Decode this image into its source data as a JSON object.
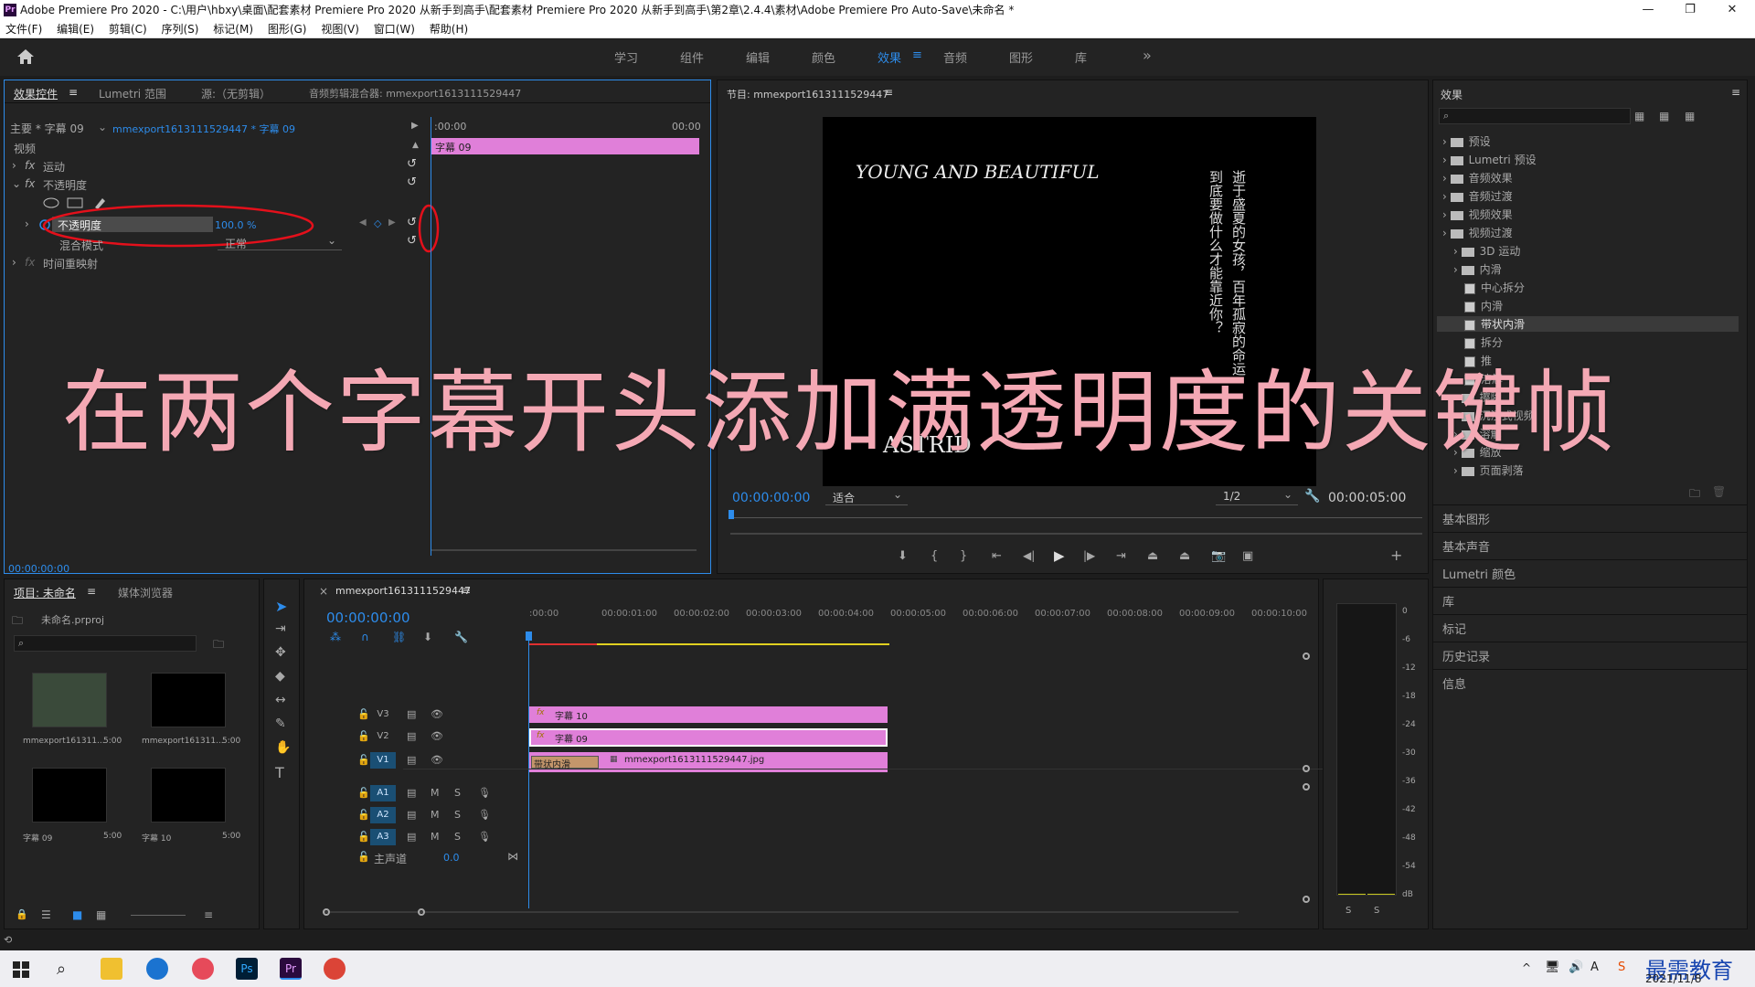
{
  "window": {
    "title": "Adobe Premiere Pro 2020 - C:\\用户\\hbxy\\桌面\\配套素材 Premiere Pro 2020 从新手到高手\\配套素材 Premiere Pro 2020 从新手到高手\\第2章\\2.4.4\\素材\\Adobe Premiere Pro Auto-Save\\未命名 *",
    "logo": "Pr",
    "minimize": "—",
    "restore": "❐",
    "close": "✕"
  },
  "menu": [
    "文件(F)",
    "编辑(E)",
    "剪辑(C)",
    "序列(S)",
    "标记(M)",
    "图形(G)",
    "视图(V)",
    "窗口(W)",
    "帮助(H)"
  ],
  "workspace_tabs": [
    "学习",
    "组件",
    "编辑",
    "颜色",
    "效果",
    "音频",
    "图形",
    "库"
  ],
  "workspace_active": "效果",
  "workspace_more": "»",
  "effect_controls": {
    "tabs": [
      "效果控件",
      "Lumetri 范围",
      "源:（无剪辑）",
      "音频剪辑混合器: mmexport1613111529447"
    ],
    "master_label": "主要 * 字幕 09",
    "sequence_label": "mmexport1613111529447 * 字幕 09",
    "time_start": ":00:00",
    "time_end": "00:00",
    "clip_name": "字幕 09",
    "video_label": "视频",
    "motion": "运动",
    "opacity_group": "不透明度",
    "opacity_prop": "不透明度",
    "opacity_value": "100.0 %",
    "blend_mode_label": "混合模式",
    "blend_mode_value": "正常",
    "time_remap": "时间重映射",
    "fx": "fx",
    "timecode": "00:00:00:00"
  },
  "program_monitor": {
    "title": "节目: mmexport1613111529447",
    "screen_title_en": "YOUNG AND BEAUTIFUL",
    "screen_vertical_1": "逝于盛夏的女孩，百年孤寂的命运",
    "screen_vertical_2": "到底要做什么才能靠近你？",
    "screen_name": "ASTRID",
    "timecode": "00:00:00:00",
    "fit": "适合",
    "resolution": "1/2",
    "duration": "00:00:05:00"
  },
  "effects_panel": {
    "title": "效果",
    "tree": [
      {
        "label": "预设",
        "level": 0,
        "type": "folder"
      },
      {
        "label": "Lumetri 预设",
        "level": 0,
        "type": "folder"
      },
      {
        "label": "音频效果",
        "level": 0,
        "type": "folder"
      },
      {
        "label": "音频过渡",
        "level": 0,
        "type": "folder"
      },
      {
        "label": "视频效果",
        "level": 0,
        "type": "folder"
      },
      {
        "label": "视频过渡",
        "level": 0,
        "type": "folder"
      },
      {
        "label": "3D 运动",
        "level": 1,
        "type": "folder"
      },
      {
        "label": "内滑",
        "level": 1,
        "type": "folder"
      },
      {
        "label": "中心拆分",
        "level": 2,
        "type": "fx"
      },
      {
        "label": "内滑",
        "level": 2,
        "type": "fx"
      },
      {
        "label": "带状内滑",
        "level": 2,
        "type": "fx",
        "selected": true
      },
      {
        "label": "拆分",
        "level": 2,
        "type": "fx"
      },
      {
        "label": "推",
        "level": 2,
        "type": "fx"
      },
      {
        "label": "溶解",
        "level": 2,
        "type": "fx"
      },
      {
        "label": "擦除",
        "level": 1,
        "type": "folder"
      },
      {
        "label": "沉浸式视频",
        "level": 1,
        "type": "folder"
      },
      {
        "label": "溶解",
        "level": 1,
        "type": "folder"
      },
      {
        "label": "缩放",
        "level": 1,
        "type": "folder"
      },
      {
        "label": "页面剥落",
        "level": 1,
        "type": "folder"
      }
    ],
    "sections": [
      "基本图形",
      "基本声音",
      "Lumetri 颜色",
      "库",
      "标记",
      "历史记录",
      "信息"
    ]
  },
  "project_panel": {
    "tabs": [
      "项目: 未命名",
      "媒体浏览器"
    ],
    "project_file": "未命名.prproj",
    "items": [
      {
        "name": "mmexport161311...",
        "duration": "5:00"
      },
      {
        "name": "mmexport161311...",
        "duration": "5:00"
      },
      {
        "name": "字幕 09",
        "duration": "5:00"
      },
      {
        "name": "字幕 10",
        "duration": "5:00"
      }
    ]
  },
  "timeline": {
    "sequence": "mmexport1613111529447",
    "timecode": "00:00:00:00",
    "ruler": [
      ":00:00",
      "00:00:01:00",
      "00:00:02:00",
      "00:00:03:00",
      "00:00:04:00",
      "00:00:05:00",
      "00:00:06:00",
      "00:00:07:00",
      "00:00:08:00",
      "00:00:09:00",
      "00:00:10:00",
      "0"
    ],
    "tracks_video": [
      "V3",
      "V2",
      "V1"
    ],
    "tracks_audio": [
      "A1",
      "A2",
      "A3"
    ],
    "master": "主声道",
    "master_value": "0.0",
    "clip_v3": "字幕 10",
    "clip_v2": "字幕 09",
    "clip_v1": "mmexport1613111529447.jpg",
    "transition": "带状内滑",
    "mute": "M",
    "solo": "S",
    "fx": "fx"
  },
  "audio_meter": {
    "scale": [
      "0",
      "-6",
      "-12",
      "-18",
      "-24",
      "-30",
      "-36",
      "-42",
      "-48",
      "-54",
      "dB"
    ],
    "buttons": [
      "S",
      "S"
    ]
  },
  "overlay_caption": "在两个字幕开头添加满透明度的关键帧",
  "taskbar": {
    "date": "2021/11/8",
    "watermark": "最需教育",
    "ime": "A"
  }
}
